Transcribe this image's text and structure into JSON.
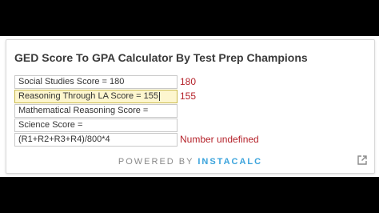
{
  "calculator": {
    "title": "GED Score To GPA Calculator By Test Prep Champions",
    "rows": [
      {
        "input": "Social Studies Score = 180",
        "result": "180"
      },
      {
        "input": "Reasoning Through LA Score = 155",
        "result": "155"
      },
      {
        "input": "Mathematical  Reasoning Score =",
        "result": ""
      },
      {
        "input": "Science Score =",
        "result": ""
      },
      {
        "input": "(R1+R2+R3+R4)/800*4",
        "result": "Number undefined"
      }
    ]
  },
  "footer": {
    "powered_by": "POWERED BY",
    "brand": "INSTACALC",
    "popout_icon": "external-link-icon"
  },
  "colors": {
    "result": "#b5232b",
    "brand": "#3aa3dc",
    "active_field_bg": "#fdf6cf"
  }
}
